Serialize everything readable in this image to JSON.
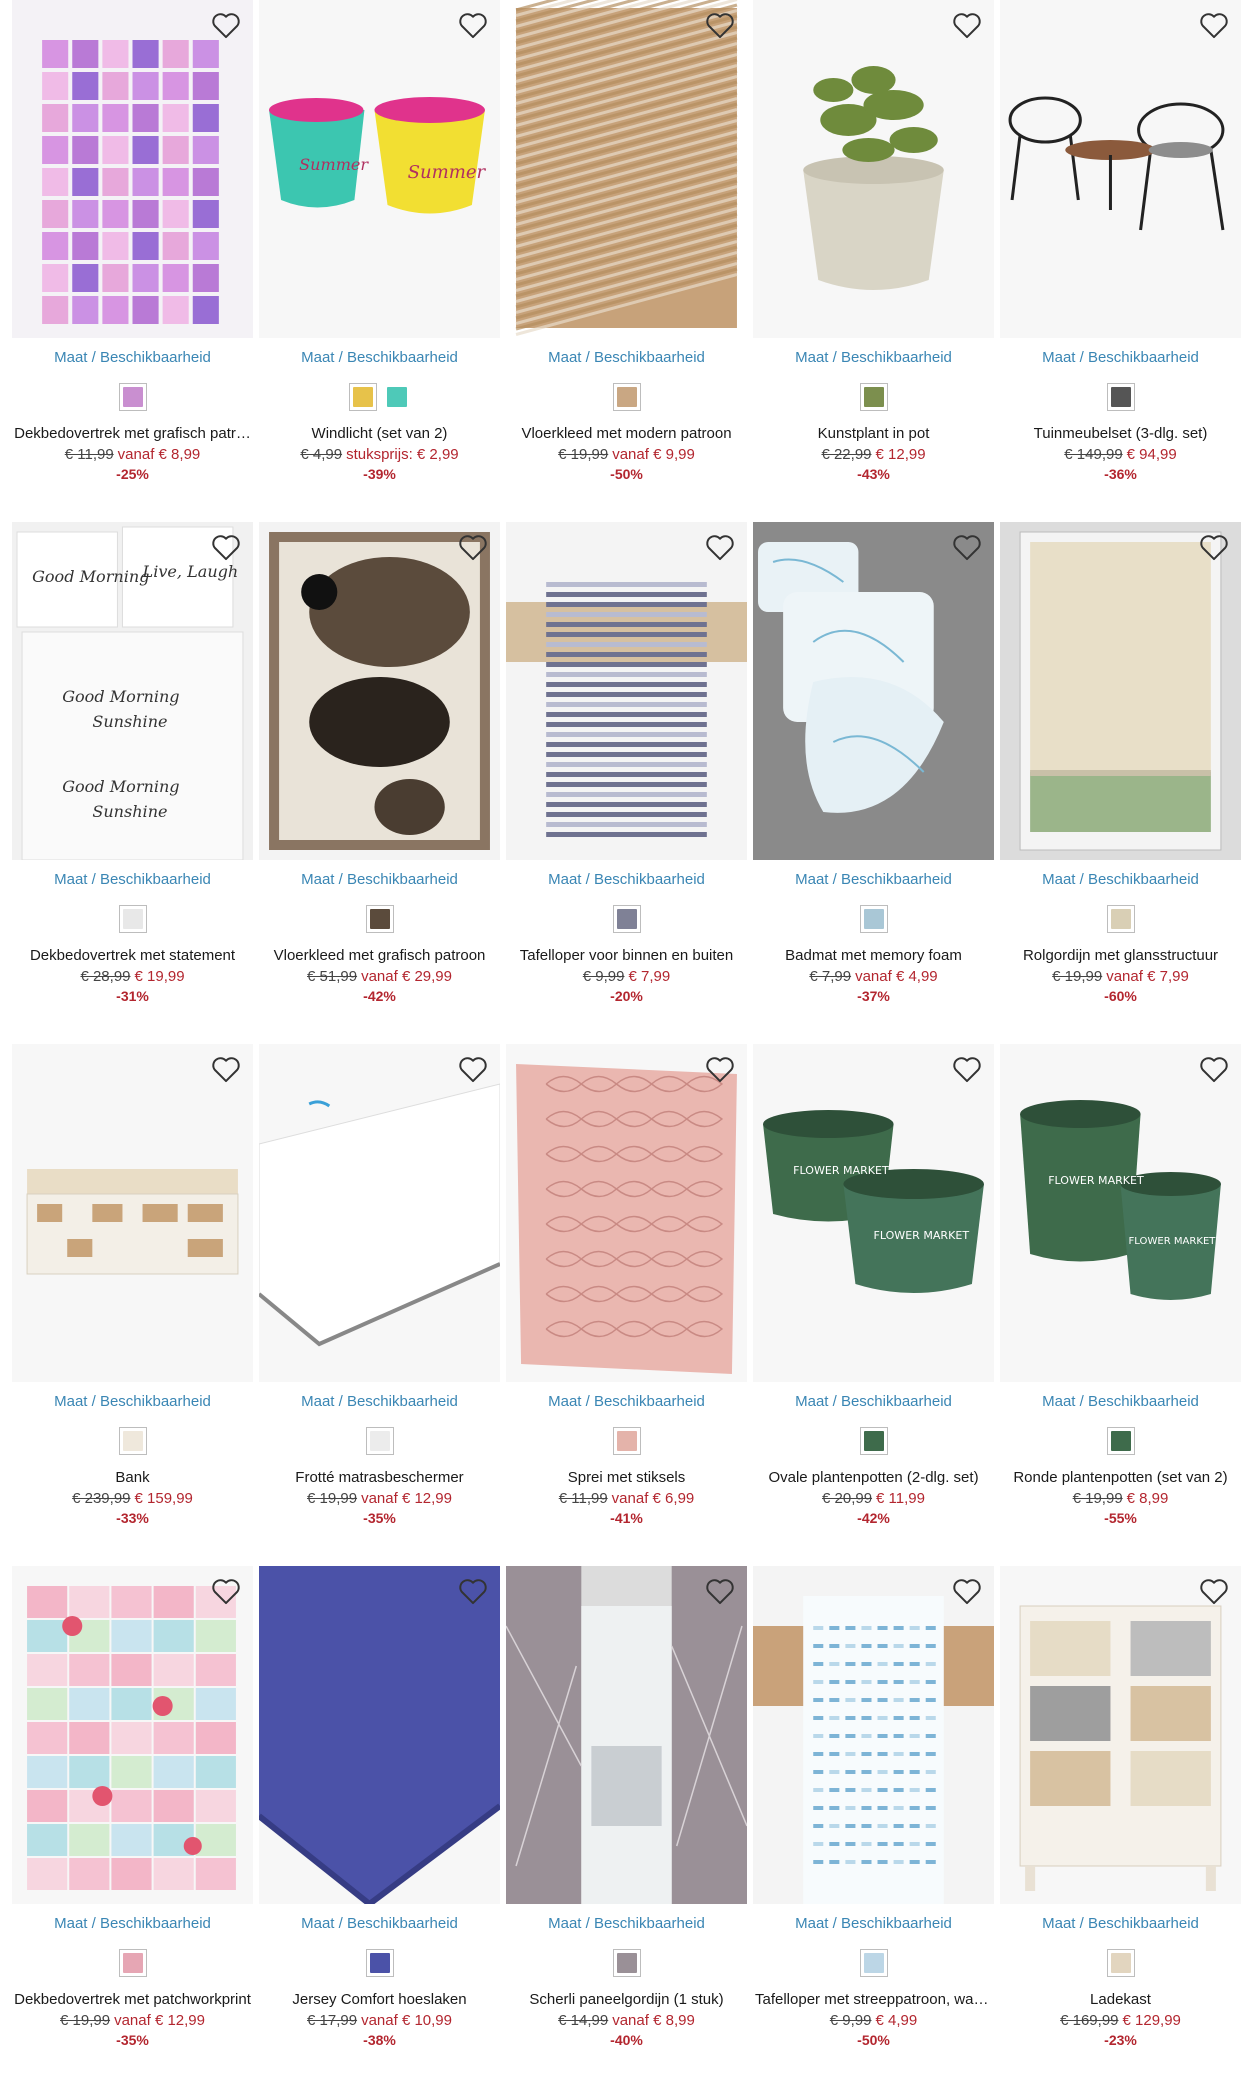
{
  "common": {
    "size_link": "Maat / Beschikbaarheid"
  },
  "colors": {
    "price_red": "#b3262f",
    "link_blue": "#3a86b4",
    "image_bg": "#f2f2f2"
  },
  "products": [
    {
      "name": "Dekbedovertrek met grafisch patr…",
      "old_price": "€ 11,99",
      "prefix": "vanaf",
      "price": "€ 8,99",
      "discount": "-25%",
      "swatches": [
        "#c98fd0"
      ],
      "icon": "bedding-icon"
    },
    {
      "name": "Windlicht (set van 2)",
      "old_price": "€ 4,99",
      "prefix": "stuksprijs:",
      "price": "€ 2,99",
      "discount": "-39%",
      "swatches": [
        "#e7c24a",
        "#4ec9b8"
      ],
      "icon": "candle-holder-icon"
    },
    {
      "name": "Vloerkleed met modern patroon",
      "old_price": "€ 19,99",
      "prefix": "vanaf",
      "price": "€ 9,99",
      "discount": "-50%",
      "swatches": [
        "#c9a783"
      ],
      "icon": "rug-icon"
    },
    {
      "name": "Kunstplant in pot",
      "old_price": "€ 22,99",
      "prefix": "",
      "price": "€ 12,99",
      "discount": "-43%",
      "swatches": [
        "#7c8f4e"
      ],
      "icon": "plant-icon"
    },
    {
      "name": "Tuinmeubelset (3-dlg. set)",
      "old_price": "€ 149,99",
      "prefix": "",
      "price": "€ 94,99",
      "discount": "-36%",
      "swatches": [
        "#555555"
      ],
      "icon": "chair-icon"
    },
    {
      "name": "Dekbedovertrek met statement",
      "old_price": "€ 28,99",
      "prefix": "",
      "price": "€ 19,99",
      "discount": "-31%",
      "swatches": [
        "#e8e8e8"
      ],
      "icon": "bedding-icon"
    },
    {
      "name": "Vloerkleed met grafisch patroon",
      "old_price": "€ 51,99",
      "prefix": "vanaf",
      "price": "€ 29,99",
      "discount": "-42%",
      "swatches": [
        "#5b4b3c"
      ],
      "icon": "rug-icon"
    },
    {
      "name": "Tafelloper voor binnen en buiten",
      "old_price": "€ 9,99",
      "prefix": "",
      "price": "€ 7,99",
      "discount": "-20%",
      "swatches": [
        "#7f8196"
      ],
      "icon": "table-runner-icon"
    },
    {
      "name": "Badmat met memory foam",
      "old_price": "€ 7,99",
      "prefix": "vanaf",
      "price": "€ 4,99",
      "discount": "-37%",
      "swatches": [
        "#a9c7d6"
      ],
      "icon": "bath-mat-icon"
    },
    {
      "name": "Rolgordijn met glansstructuur",
      "old_price": "€ 19,99",
      "prefix": "vanaf",
      "price": "€ 7,99",
      "discount": "-60%",
      "swatches": [
        "#d9cfb5"
      ],
      "icon": "blind-icon"
    },
    {
      "name": "Bank",
      "old_price": "€ 239,99",
      "prefix": "",
      "price": "€ 159,99",
      "discount": "-33%",
      "swatches": [
        "#efe8dc"
      ],
      "icon": "bench-icon"
    },
    {
      "name": "Frotté matrasbeschermer",
      "old_price": "€ 19,99",
      "prefix": "vanaf",
      "price": "€ 12,99",
      "discount": "-35%",
      "swatches": [
        "#ececec"
      ],
      "icon": "mattress-icon"
    },
    {
      "name": "Sprei met stiksels",
      "old_price": "€ 11,99",
      "prefix": "vanaf",
      "price": "€ 6,99",
      "discount": "-41%",
      "swatches": [
        "#e4b3aa"
      ],
      "icon": "bedspread-icon"
    },
    {
      "name": "Ovale plantenpotten (2-dlg. set)",
      "old_price": "€ 20,99",
      "prefix": "",
      "price": "€ 11,99",
      "discount": "-42%",
      "swatches": [
        "#3e6b4b"
      ],
      "icon": "planter-icon"
    },
    {
      "name": "Ronde plantenpotten (set van 2)",
      "old_price": "€ 19,99",
      "prefix": "",
      "price": "€ 8,99",
      "discount": "-55%",
      "swatches": [
        "#3e6b4b"
      ],
      "icon": "planter-icon"
    },
    {
      "name": "Dekbedovertrek met patchworkprint",
      "old_price": "€ 19,99",
      "prefix": "vanaf",
      "price": "€ 12,99",
      "discount": "-35%",
      "swatches": [
        "#e6a6b4"
      ],
      "icon": "bedding-icon"
    },
    {
      "name": "Jersey Comfort hoeslaken",
      "old_price": "€ 17,99",
      "prefix": "vanaf",
      "price": "€ 10,99",
      "discount": "-38%",
      "swatches": [
        "#4b52a8"
      ],
      "icon": "fitted-sheet-icon"
    },
    {
      "name": "Scherli paneelgordijn (1 stuk)",
      "old_price": "€ 14,99",
      "prefix": "vanaf",
      "price": "€ 8,99",
      "discount": "-40%",
      "swatches": [
        "#9a9097"
      ],
      "icon": "curtain-icon"
    },
    {
      "name": "Tafelloper met streeppatroon, wat…",
      "old_price": "€ 9,99",
      "prefix": "",
      "price": "€ 4,99",
      "discount": "-50%",
      "swatches": [
        "#bcd6e6"
      ],
      "icon": "table-runner-icon"
    },
    {
      "name": "Ladekast",
      "old_price": "€ 169,99",
      "prefix": "",
      "price": "€ 129,99",
      "discount": "-23%",
      "swatches": [
        "#e2d5bf"
      ],
      "icon": "cabinet-icon"
    }
  ]
}
